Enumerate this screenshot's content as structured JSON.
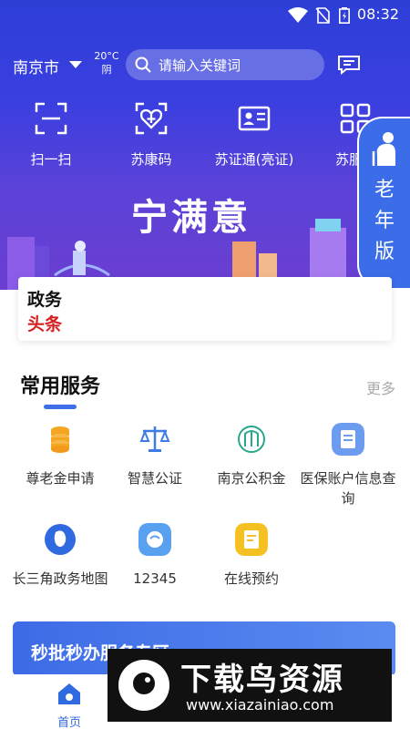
{
  "status": {
    "time": "08:32"
  },
  "header": {
    "city": "南京市",
    "weather_temp": "20°C",
    "weather_desc": "阴",
    "search_placeholder": "请输入关键词"
  },
  "quick_actions": [
    {
      "label": "扫一扫",
      "icon": "scan-icon"
    },
    {
      "label": "苏康码",
      "icon": "health-code-icon"
    },
    {
      "label": "苏证通(亮证)",
      "icon": "id-card-icon"
    },
    {
      "label": "苏服",
      "icon": "grid-icon"
    }
  ],
  "banner": {
    "title": "宁满意"
  },
  "elder_mode": {
    "label_lines": [
      "老",
      "年",
      "版"
    ]
  },
  "news": {
    "line1": "政务",
    "line2": "头条"
  },
  "common_services": {
    "title": "常用服务",
    "more": "更多",
    "items": [
      {
        "label": "尊老金申请",
        "icon": "coins-icon",
        "color": "#f5a623"
      },
      {
        "label": "智慧公证",
        "icon": "scales-icon",
        "color": "#3d7be6"
      },
      {
        "label": "南京公积金",
        "icon": "fund-icon",
        "color": "#2aa68a"
      },
      {
        "label": "医保账户信息查询",
        "icon": "doc-icon",
        "color": "#6b9cf0"
      },
      {
        "label": "长三角政务地图",
        "icon": "map-icon",
        "color": "#2f6ae0"
      },
      {
        "label": "12345",
        "icon": "phone-icon",
        "color": "#5aa0f0"
      },
      {
        "label": "在线预约",
        "icon": "calendar-icon",
        "color": "#f5c022"
      }
    ]
  },
  "promo": {
    "title": "秒批秒办服务专区"
  },
  "tabbar": {
    "home": "首页"
  },
  "watermark": {
    "title": "下载鸟资源",
    "url": "www.xiazainiao.com"
  }
}
